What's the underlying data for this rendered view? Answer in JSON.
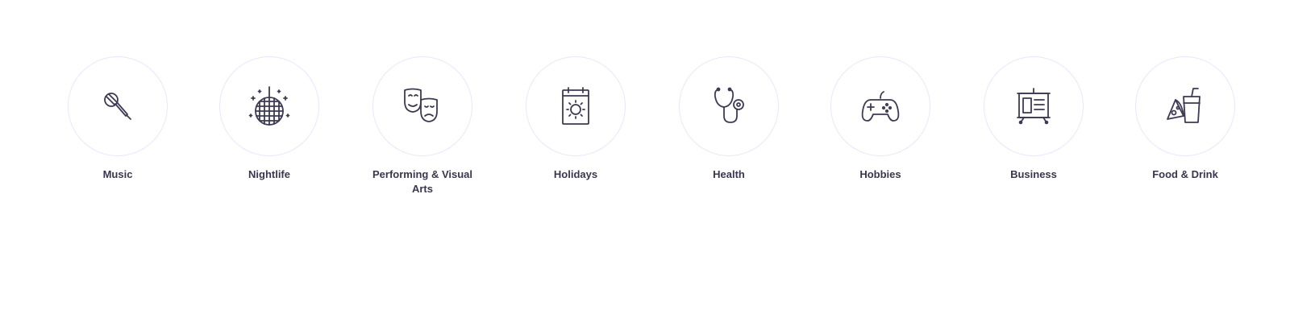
{
  "categories": [
    {
      "label": "Music",
      "icon": "microphone-icon"
    },
    {
      "label": "Nightlife",
      "icon": "disco-ball-icon"
    },
    {
      "label": "Performing & Visual Arts",
      "icon": "theater-masks-icon"
    },
    {
      "label": "Holidays",
      "icon": "calendar-sun-icon"
    },
    {
      "label": "Health",
      "icon": "stethoscope-icon"
    },
    {
      "label": "Hobbies",
      "icon": "game-controller-icon"
    },
    {
      "label": "Business",
      "icon": "presentation-board-icon"
    },
    {
      "label": "Food & Drink",
      "icon": "pizza-drink-icon"
    }
  ],
  "colors": {
    "icon_stroke": "#3d3a54",
    "circle_border": "#e8e6ff",
    "label_text": "#39364f"
  }
}
